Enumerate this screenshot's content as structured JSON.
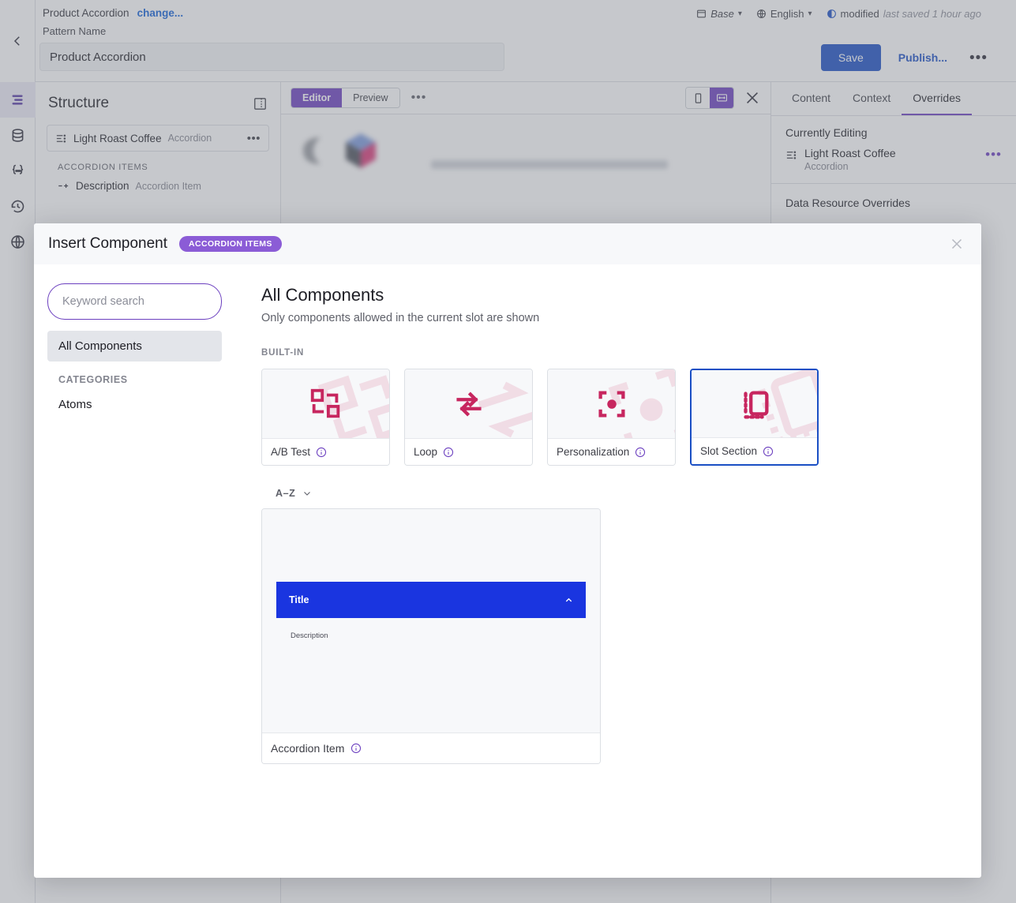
{
  "topbar": {
    "breadcrumb": "Product Accordion",
    "change_link": "change...",
    "pattern_label": "Pattern Name",
    "pattern_value": "Product Accordion",
    "base_label": "Base",
    "language_label": "English",
    "status_label": "modified",
    "saved_label": "last saved 1 hour ago",
    "save_label": "Save",
    "publish_label": "Publish...",
    "more_label": "•••"
  },
  "rail": {
    "items": [
      {
        "name": "structure-icon"
      },
      {
        "name": "data-icon"
      },
      {
        "name": "variables-icon"
      },
      {
        "name": "history-icon"
      },
      {
        "name": "globe-icon"
      }
    ]
  },
  "structure": {
    "title": "Structure",
    "node": {
      "name": "Light Roast Coffee",
      "type": "Accordion",
      "menu": "•••"
    },
    "section_caption": "ACCORDION ITEMS",
    "child": {
      "name": "Description",
      "type": "Accordion Item"
    }
  },
  "editor": {
    "tabs": [
      {
        "label": "Editor",
        "active": true
      },
      {
        "label": "Preview",
        "active": false
      }
    ],
    "more": "•••",
    "viewports": [
      {
        "name": "mobile-viewport-icon",
        "active": false
      },
      {
        "name": "desktop-viewport-icon",
        "active": true
      }
    ]
  },
  "rightpanel": {
    "tabs": [
      {
        "label": "Content",
        "active": false
      },
      {
        "label": "Context",
        "active": false
      },
      {
        "label": "Overrides",
        "active": true
      }
    ],
    "currently_editing_label": "Currently Editing",
    "node": {
      "name": "Light Roast Coffee",
      "type": "Accordion",
      "menu": "•••"
    },
    "data_resource_label": "Data Resource Overrides"
  },
  "modal": {
    "title": "Insert Component",
    "badge": "ACCORDION ITEMS",
    "search": {
      "value": "",
      "placeholder": "Keyword search"
    },
    "sidebar": {
      "all_components": "All Components",
      "categories_caption": "CATEGORIES",
      "categories": [
        "Atoms"
      ]
    },
    "main": {
      "heading": "All Components",
      "subheading": "Only components allowed in the current slot are shown",
      "group_caption": "BUILT-IN",
      "builtin": [
        {
          "label": "A/B Test",
          "icon": "ab-test-icon",
          "selected": false
        },
        {
          "label": "Loop",
          "icon": "loop-icon",
          "selected": false
        },
        {
          "label": "Personalization",
          "icon": "personalization-icon",
          "selected": false
        },
        {
          "label": "Slot Section",
          "icon": "slot-section-icon",
          "selected": true
        }
      ],
      "sort_label": "A–Z",
      "components": [
        {
          "label": "Accordion Item",
          "preview": {
            "title": "Title",
            "description": "Description"
          }
        }
      ]
    }
  },
  "colors": {
    "accent_purple": "#6b3fbf",
    "badge_purple": "#8b5cd6",
    "brand_blue": "#1a4fc4",
    "selected_border": "#1a4fc4",
    "icon_magenta": "#c7265f",
    "preview_blue": "#1a35e0"
  }
}
